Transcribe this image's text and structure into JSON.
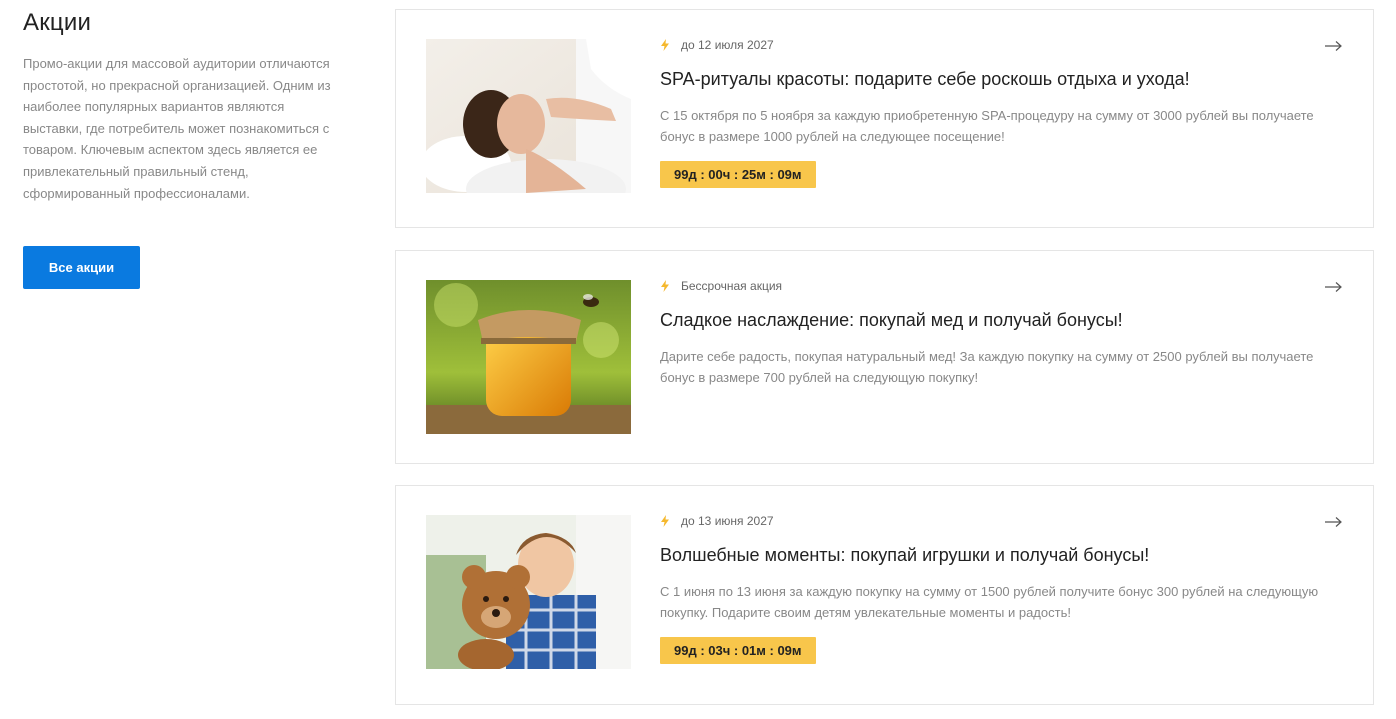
{
  "sidebar": {
    "title": "Акции",
    "description": "Промо-акции для массовой аудитории отличаются простотой, но прекрасной организацией. Одним из наиболее популярных вариантов являются выставки, где потребитель может познакомиться с товаром. Ключевым аспектом здесь является ее привлекательный правильный стенд, сформированный профессионалами.",
    "all_button": "Все акции"
  },
  "promos": [
    {
      "meta": "до 12 июля 2027",
      "title": "SPA-ритуалы красоты: подарите себе роскошь отдыха и ухода!",
      "description": "С 15 октября по 5 ноября за каждую приобретенную SPA-процедуру на сумму от 3000 рублей вы получаете бонус в размере 1000 рублей на следующее посещение!",
      "timer": "99д : 00ч : 25м : 09м"
    },
    {
      "meta": "Бессрочная акция",
      "title": "Сладкое наслаждение: покупай мед и получай бонусы!",
      "description": "Дарите себе радость, покупая натуральный мед! За каждую покупку на сумму от 2500 рублей вы получаете бонус в размере 700 рублей на следующую покупку!"
    },
    {
      "meta": "до 13 июня 2027",
      "title": "Волшебные моменты: покупай игрушки и получай бонусы!",
      "description": "С  1 июня по 13 июня за каждую покупку на сумму от 1500 рублей получите бонус 300 рублей на следующую покупку. Подарите своим детям увлекательные моменты и радость!",
      "timer": "99д : 03ч : 01м : 09м"
    }
  ],
  "colors": {
    "accent": "#0a7ae0",
    "timer": "#f8c64b",
    "bolt": "#f5b82e"
  },
  "icons": [
    "lightning-icon",
    "arrow-right-icon"
  ]
}
